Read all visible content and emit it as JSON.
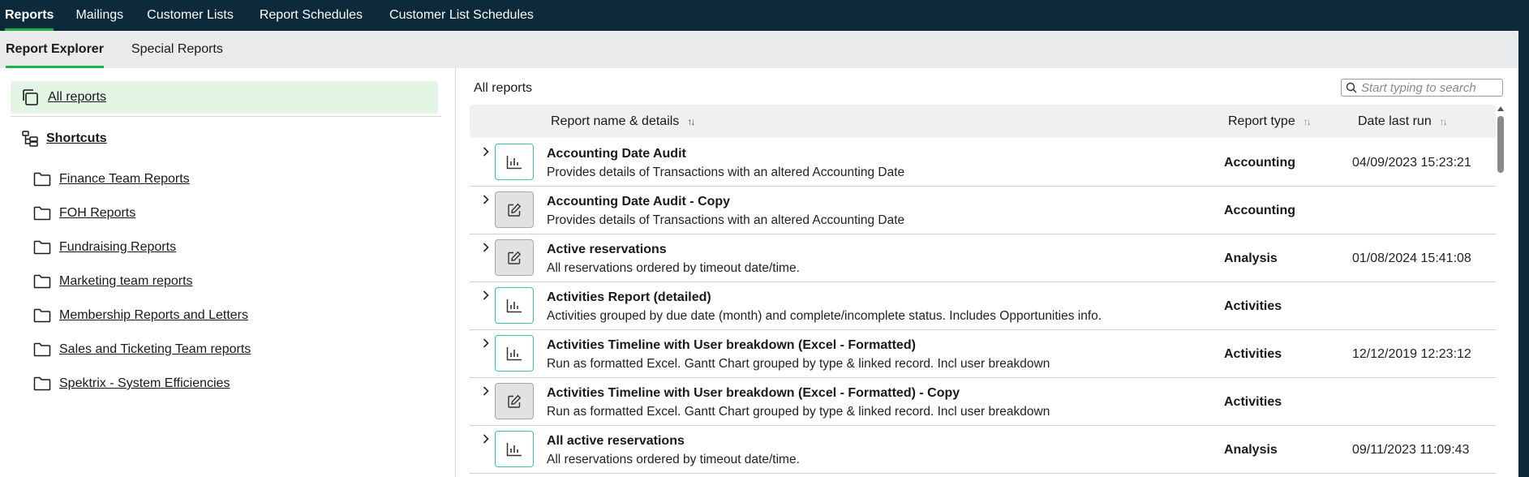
{
  "topnav": {
    "tabs": [
      {
        "label": "Reports",
        "active": true
      },
      {
        "label": "Mailings"
      },
      {
        "label": "Customer Lists"
      },
      {
        "label": "Report Schedules"
      },
      {
        "label": "Customer List Schedules"
      }
    ]
  },
  "subnav": {
    "tabs": [
      {
        "label": "Report Explorer",
        "active": true
      },
      {
        "label": "Special Reports"
      }
    ]
  },
  "sidebar": {
    "all_reports": "All reports",
    "shortcuts": "Shortcuts",
    "folders": [
      "Finance Team Reports",
      "FOH Reports",
      "Fundraising Reports",
      "Marketing team reports",
      "Membership Reports and Letters",
      "Sales and Ticketing Team reports",
      "Spektrix - System Efficiencies"
    ]
  },
  "main": {
    "title": "All reports",
    "search_placeholder": "Start typing to search",
    "columns": {
      "name": "Report name & details",
      "type": "Report type",
      "date": "Date last run"
    },
    "rows": [
      {
        "icon": "chart-icon",
        "name": "Accounting Date Audit",
        "desc": "Provides details of Transactions with an altered Accounting Date",
        "type": "Accounting",
        "date": "04/09/2023 15:23:21"
      },
      {
        "icon": "edit-icon",
        "name": "Accounting Date Audit - Copy",
        "desc": "Provides details of Transactions with an altered Accounting Date",
        "type": "Accounting",
        "date": ""
      },
      {
        "icon": "edit-icon",
        "name": "Active reservations",
        "desc": "All reservations ordered by timeout date/time.",
        "type": "Analysis",
        "date": "01/08/2024 15:41:08"
      },
      {
        "icon": "chart-icon",
        "name": "Activities Report (detailed)",
        "desc": "Activities grouped by due date (month) and complete/incomplete status. Includes Opportunities info.",
        "type": "Activities",
        "date": ""
      },
      {
        "icon": "chart-icon",
        "name": "Activities Timeline with User breakdown (Excel - Formatted)",
        "desc": "Run as formatted Excel. Gantt Chart grouped by type & linked record. Incl user breakdown",
        "type": "Activities",
        "date": "12/12/2019 12:23:12"
      },
      {
        "icon": "edit-icon",
        "name": "Activities Timeline with User breakdown (Excel - Formatted) - Copy",
        "desc": "Run as formatted Excel. Gantt Chart grouped by type & linked record. Incl user breakdown",
        "type": "Activities",
        "date": ""
      },
      {
        "icon": "chart-icon",
        "name": "All active reservations",
        "desc": "All reservations ordered by timeout date/time.",
        "type": "Analysis",
        "date": "09/11/2023 11:09:43"
      }
    ]
  },
  "colors": {
    "nav_bg": "#0d2a3a",
    "accent_green": "#22b04b",
    "selected_bg": "#e3f5e5",
    "chart_icon_teal": "#39c3b9"
  }
}
